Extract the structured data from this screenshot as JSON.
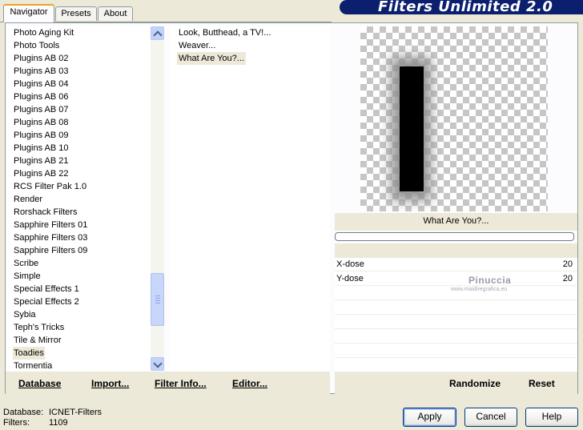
{
  "tabs": [
    "Navigator",
    "Presets",
    "About"
  ],
  "banner_title": "Filters Unlimited 2.0",
  "categories": [
    "Photo Aging Kit",
    "Photo Tools",
    "Plugins AB 02",
    "Plugins AB 03",
    "Plugins AB 04",
    "Plugins AB 06",
    "Plugins AB 07",
    "Plugins AB 08",
    "Plugins AB 09",
    "Plugins AB 10",
    "Plugins AB 21",
    "Plugins AB 22",
    "RCS Filter Pak 1.0",
    "Render",
    "Rorshack Filters",
    "Sapphire Filters 01",
    "Sapphire Filters 03",
    "Sapphire Filters 09",
    "Scribe",
    "Simple",
    "Special Effects 1",
    "Special Effects 2",
    "Sybia",
    "Teph's Tricks",
    "Tile & Mirror",
    "Toadies",
    "Tormentia"
  ],
  "selected_category": "Toadies",
  "filters": [
    "Look, Butthead, a TV!...",
    "Weaver...",
    "What Are You?..."
  ],
  "selected_filter": "What Are You?...",
  "links": {
    "database": "Database",
    "import": "Import...",
    "filter_info": "Filter Info...",
    "editor": "Editor...",
    "randomize": "Randomize",
    "reset": "Reset"
  },
  "current_filter_name": "What Are You?...",
  "params": [
    {
      "label": "X-dose",
      "value": "20"
    },
    {
      "label": "Y-dose",
      "value": "20"
    }
  ],
  "watermark": {
    "title": "Pinuccia",
    "subtitle": "www.maidiregrafica.eu"
  },
  "status": {
    "database_label": "Database:",
    "database_value": "ICNET-Filters",
    "filters_label": "Filters:",
    "filters_value": "1109"
  },
  "buttons": {
    "apply": "Apply",
    "cancel": "Cancel",
    "help": "Help"
  }
}
